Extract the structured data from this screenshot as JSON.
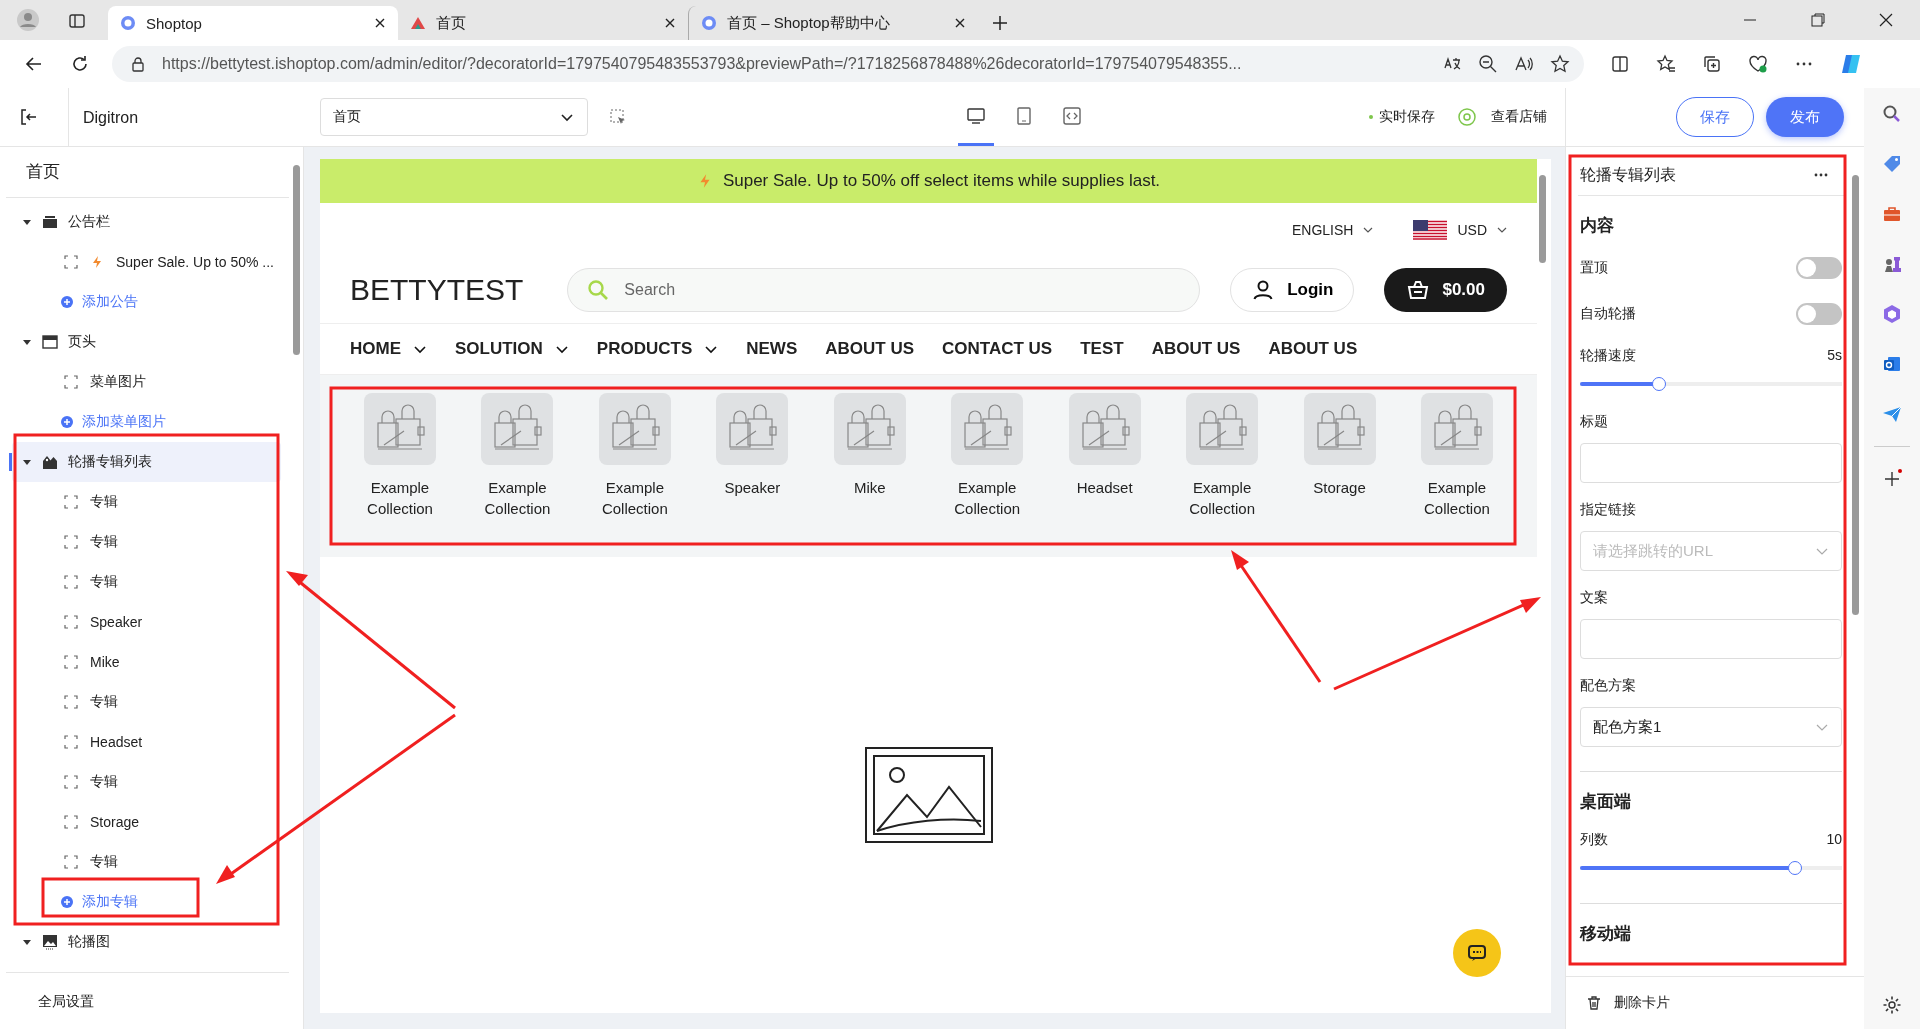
{
  "browser": {
    "tabs": [
      {
        "title": "Shoptop",
        "kind": "shoptop",
        "selected": true
      },
      {
        "title": "首页",
        "kind": "peak",
        "selected": false
      },
      {
        "title": "首页 – Shoptop帮助中心",
        "kind": "shoptop",
        "selected": false
      }
    ],
    "url": "https://bettytest.ishoptop.com/admin/editor/?decoratorId=1797540795483553793&previewPath=/?1718256878488%26decoratorId=179754079548355..."
  },
  "editor": {
    "store_name": "Digitron",
    "page_select": "首页",
    "devices": [
      {
        "kind": "desktop",
        "selected": true
      },
      {
        "kind": "tablet",
        "selected": false
      },
      {
        "kind": "code",
        "selected": false
      }
    ],
    "autosave": "实时保存",
    "view_store": "查看店铺",
    "save": "保存",
    "publish": "发布"
  },
  "sidebar": {
    "title": "首页",
    "tree": [
      {
        "label": "公告栏",
        "kind": "bar",
        "expanded": true,
        "selected": false,
        "children": [
          {
            "label": "Super Sale. Up to 50% ...",
            "kind": "announcement"
          }
        ],
        "add": "添加公告"
      },
      {
        "label": "页头",
        "kind": "header",
        "expanded": true,
        "selected": false,
        "children": [
          {
            "label": "菜单图片",
            "kind": "item"
          }
        ],
        "add": "添加菜单图片"
      },
      {
        "label": "轮播专辑列表",
        "kind": "tags",
        "expanded": true,
        "selected": true,
        "children": [
          {
            "label": "专辑",
            "kind": "item"
          },
          {
            "label": "专辑",
            "kind": "item"
          },
          {
            "label": "专辑",
            "kind": "item"
          },
          {
            "label": "Speaker",
            "kind": "item"
          },
          {
            "label": "Mike",
            "kind": "item"
          },
          {
            "label": "专辑",
            "kind": "item"
          },
          {
            "label": "Headset",
            "kind": "item"
          },
          {
            "label": "专辑",
            "kind": "item"
          },
          {
            "label": "Storage",
            "kind": "item"
          },
          {
            "label": "专辑",
            "kind": "item"
          }
        ],
        "add": "添加专辑"
      },
      {
        "label": "轮播图",
        "kind": "image",
        "expanded": true,
        "selected": false
      }
    ],
    "footer": "全局设置"
  },
  "preview": {
    "announcement": "Super Sale. Up to 50% off select items while supplies last.",
    "language": "ENGLISH",
    "currency": "USD",
    "logo": "BETTYTEST",
    "search_placeholder": "Search",
    "login": "Login",
    "cart": "$0.00",
    "nav": [
      {
        "label": "HOME",
        "dropdown": true
      },
      {
        "label": "SOLUTION",
        "dropdown": true
      },
      {
        "label": "PRODUCTS",
        "dropdown": true
      },
      {
        "label": "NEWS",
        "dropdown": false
      },
      {
        "label": "ABOUT US",
        "dropdown": false
      },
      {
        "label": "CONTACT US",
        "dropdown": false
      },
      {
        "label": "TEST",
        "dropdown": false
      },
      {
        "label": "ABOUT US",
        "dropdown": false
      },
      {
        "label": "ABOUT US",
        "dropdown": false
      }
    ],
    "collections": [
      "Example Collection",
      "Example Collection",
      "Example Collection",
      "Speaker",
      "Mike",
      "Example Collection",
      "Headset",
      "Example Collection",
      "Storage",
      "Example Collection"
    ]
  },
  "panel": {
    "title": "轮播专辑列表",
    "items": [
      {
        "kind": "heading",
        "label": "内容"
      },
      {
        "kind": "toggle",
        "label": "置顶",
        "on": false
      },
      {
        "kind": "toggle",
        "label": "自动轮播",
        "on": false
      },
      {
        "kind": "slider",
        "label": "轮播速度",
        "reading": "5s",
        "level": 0.3
      },
      {
        "kind": "input",
        "label": "标题"
      },
      {
        "kind": "select",
        "label": "指定链接",
        "placeholder": "请选择跳转的URL"
      },
      {
        "kind": "input",
        "label": "文案"
      },
      {
        "kind": "select",
        "label": "配色方案",
        "value": "配色方案1"
      },
      {
        "kind": "heading",
        "label": "桌面端"
      },
      {
        "kind": "slider",
        "label": "列数",
        "reading": "10",
        "level": 0.82
      },
      {
        "kind": "heading",
        "label": "移动端"
      }
    ],
    "delete": "删除卡片"
  }
}
